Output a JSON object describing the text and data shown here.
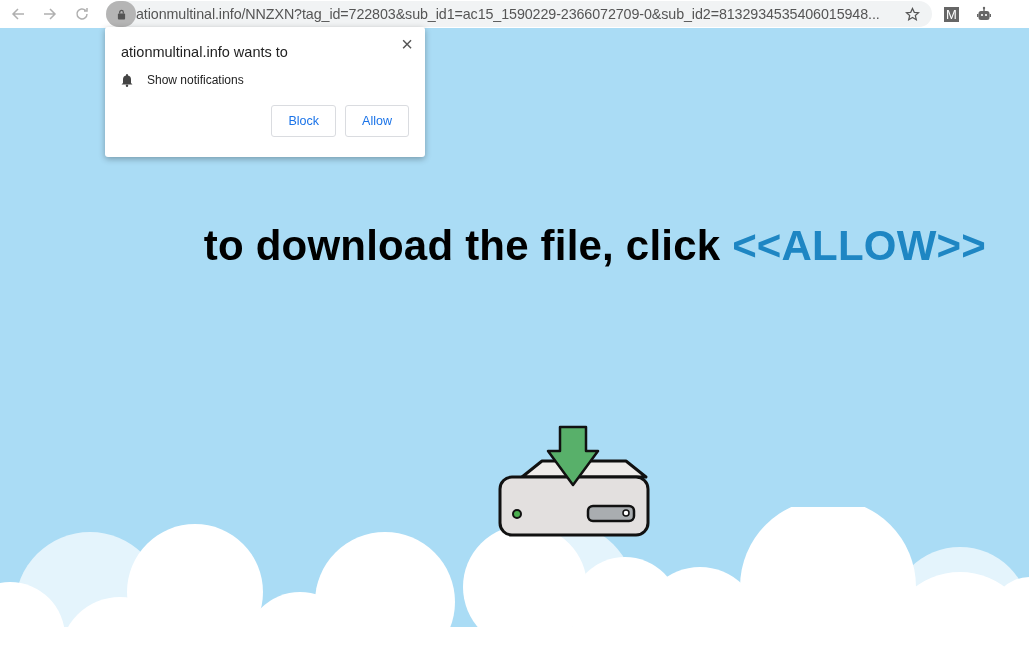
{
  "browser": {
    "url": "ationmultinal.info/NNZXN?tag_id=722803&sub_id1=ac15_1590229-2366072709-0&sub_id2=8132934535406015948...",
    "extension_letter": "M"
  },
  "permission_popup": {
    "title": "ationmultinal.info wants to",
    "permission": "Show notifications",
    "buttons": [
      "Block",
      "Allow"
    ],
    "close": "×"
  },
  "headline": {
    "text": "to download the file, click",
    "emphasis": "<<ALLOW>>"
  }
}
